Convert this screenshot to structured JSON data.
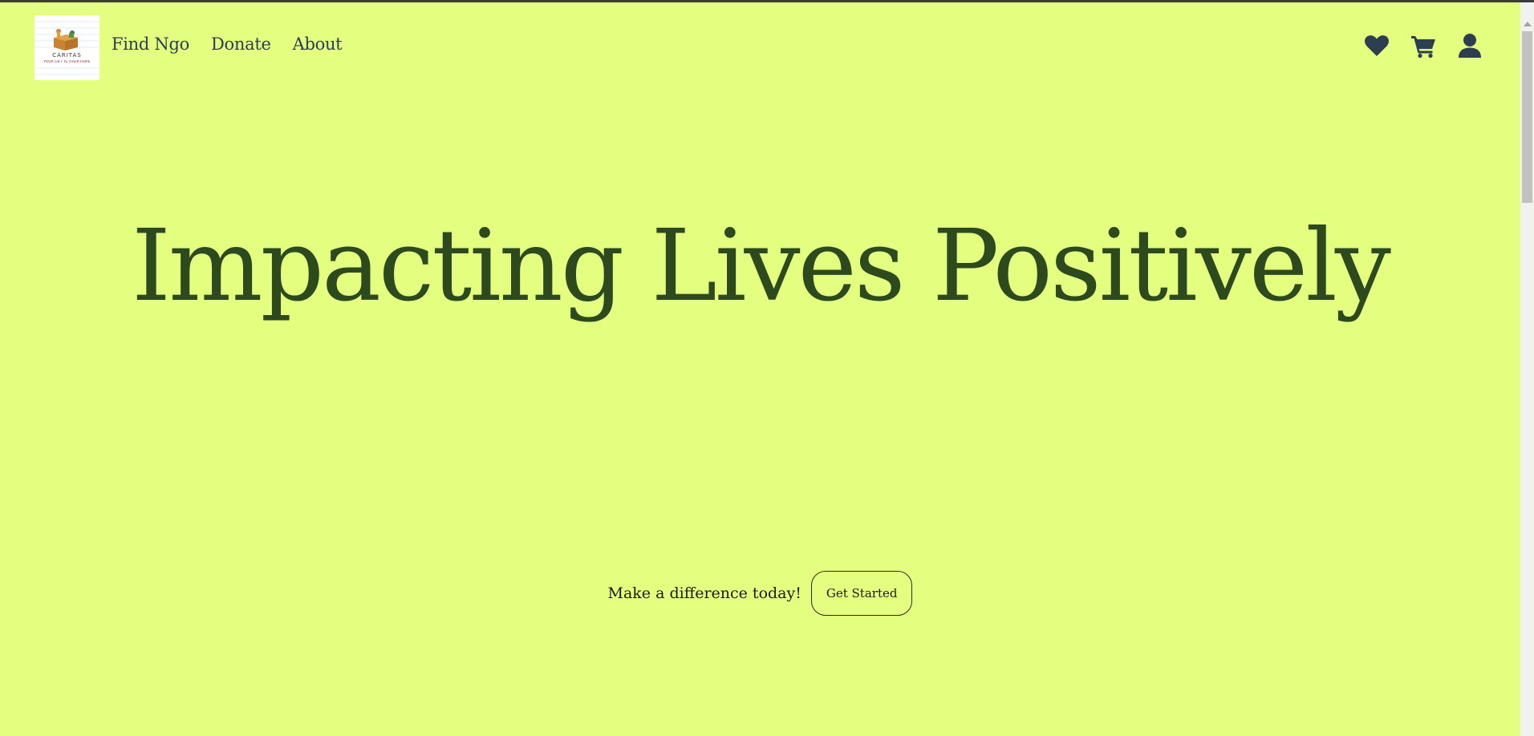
{
  "logo": {
    "name": "CARITAS",
    "tagline": "YOUR GIFT IS THEIR HOPE"
  },
  "nav": {
    "links": [
      {
        "label": "Find Ngo"
      },
      {
        "label": "Donate"
      },
      {
        "label": "About"
      }
    ],
    "icons": [
      "heart-icon",
      "cart-icon",
      "user-icon"
    ]
  },
  "hero": {
    "title": "Impacting Lives Positively"
  },
  "cta": {
    "text": "Make a difference today!",
    "button_label": "Get Started"
  },
  "colors": {
    "background": "#e4ff80",
    "title": "#2d4a1e",
    "nav": "#2c3e50"
  }
}
